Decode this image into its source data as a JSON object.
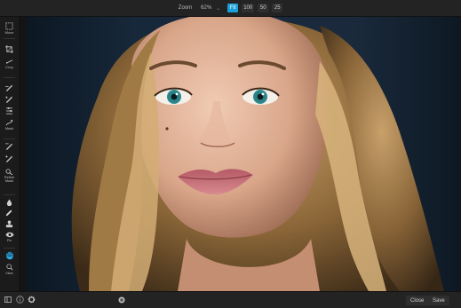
{
  "topbar": {
    "zoom_label": "Zoom",
    "zoom_value": "62%",
    "zoom_caret": "⌄",
    "zoom_buttons": [
      "Fit",
      "100",
      "50",
      "25"
    ],
    "active_zoom": "Fit"
  },
  "toolbar": {
    "tools": [
      {
        "label": "Move",
        "icon": "move-icon"
      },
      {
        "label": "Crop",
        "icon": "crop-icon"
      },
      {
        "label": "",
        "icon": "brush-icon"
      },
      {
        "label": "",
        "icon": "brush-alt-icon"
      },
      {
        "label": "",
        "icon": "mask-adjust-icon"
      },
      {
        "label": "Mask",
        "icon": "mask-icon"
      },
      {
        "label": "",
        "icon": "refine-brush-icon"
      },
      {
        "label": "",
        "icon": "refine-brush-alt-icon"
      },
      {
        "label": "Refine Mask",
        "icon": "refine-mask-icon"
      },
      {
        "label": "",
        "icon": "drop-icon"
      },
      {
        "label": "",
        "icon": "retouch-icon"
      },
      {
        "label": "",
        "icon": "clone-stamp-icon"
      },
      {
        "label": "Fix",
        "icon": "eye-icon"
      },
      {
        "label": "",
        "icon": "hand-icon"
      },
      {
        "label": "",
        "icon": "zoom-icon"
      },
      {
        "label": "View",
        "icon": "view-icon"
      }
    ]
  },
  "bottombar": {
    "icons": [
      "panel-toggle-icon",
      "info-icon",
      "gear-icon",
      "preview-icon"
    ],
    "close_label": "Close",
    "save_label": "Save"
  },
  "colors": {
    "accent": "#1a9fd8",
    "bar_bg": "#232323",
    "toolbar_bg": "#1b1b1b"
  }
}
